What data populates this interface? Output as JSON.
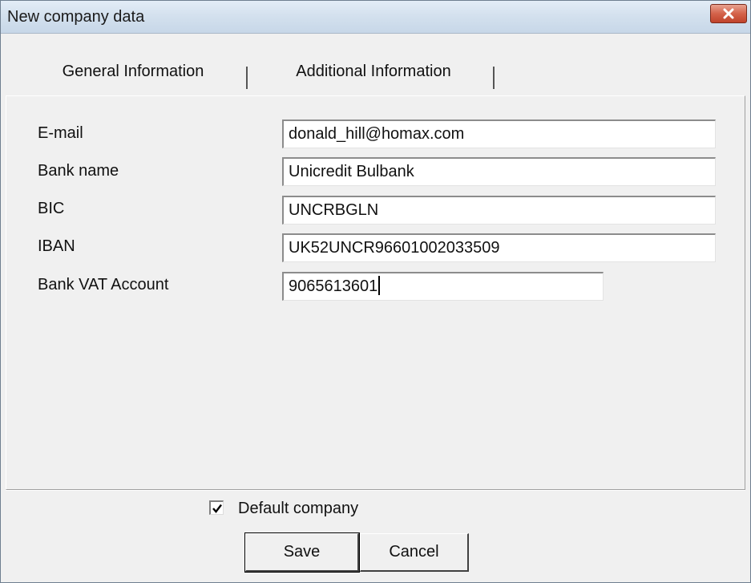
{
  "window": {
    "title": "New company data",
    "close_icon": "close-icon"
  },
  "tabs": [
    {
      "label": "General Information",
      "active": false
    },
    {
      "label": "Additional Information",
      "active": true
    }
  ],
  "form": {
    "fields": [
      {
        "label": "E-mail",
        "value": "donald_hill@homax.com"
      },
      {
        "label": "Bank name",
        "value": "Unicredit Bulbank"
      },
      {
        "label": "BIC",
        "value": "UNCRBGLN"
      },
      {
        "label": "IBAN",
        "value": "UK52UNCR96601002033509"
      },
      {
        "label": "Bank VAT Account",
        "value": "9065613601"
      }
    ]
  },
  "footer": {
    "default_company_label": "Default company",
    "default_company_checked": true,
    "save_label": "Save",
    "cancel_label": "Cancel"
  },
  "colors": {
    "titlebar": "#d4e1ee",
    "close_button": "#d4624a",
    "dialog_bg": "#f0f0f0"
  }
}
